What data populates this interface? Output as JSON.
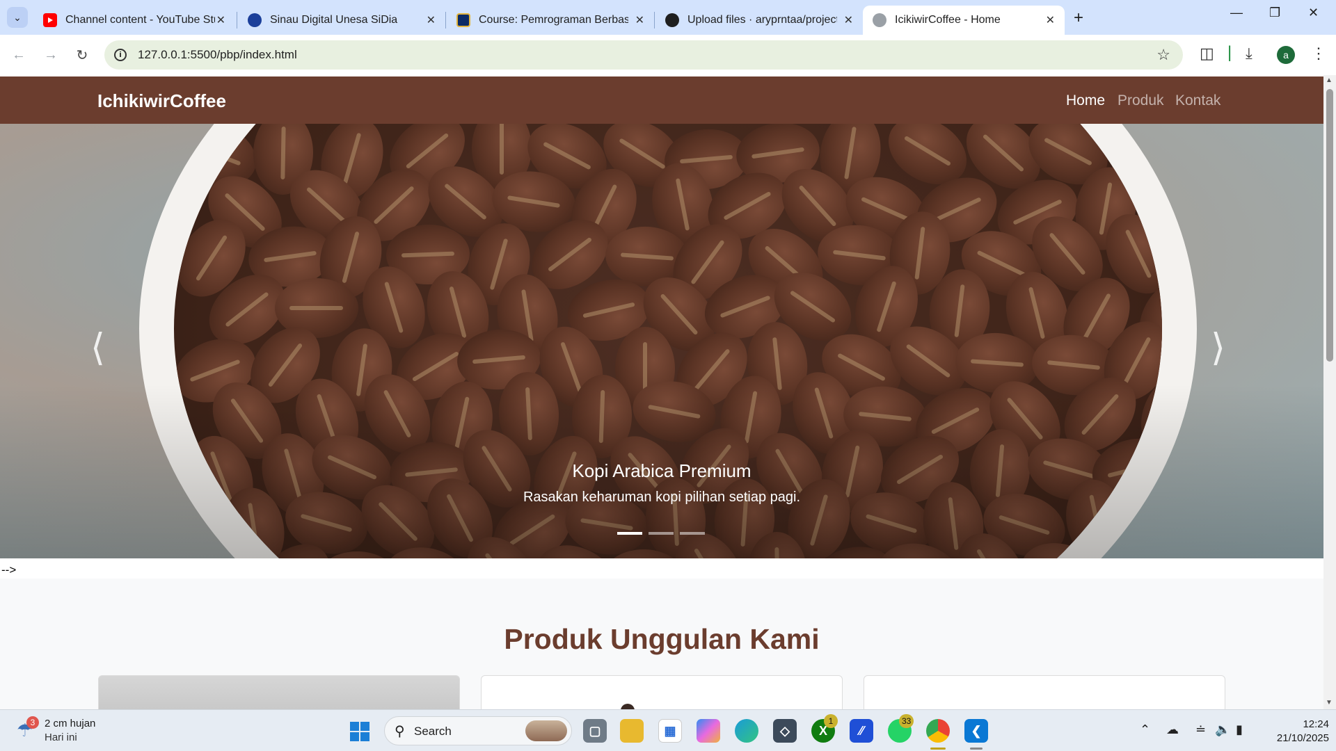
{
  "browser": {
    "tabs": [
      {
        "title": "Channel content - YouTube Stu",
        "icon": "youtube-icon",
        "active": false
      },
      {
        "title": "Sinau Digital Unesa SiDia",
        "icon": "sidia-icon",
        "active": false
      },
      {
        "title": "Course: Pemrograman Berbasis",
        "icon": "course-icon",
        "active": false
      },
      {
        "title": "Upload files · aryprntaa/project",
        "icon": "github-icon",
        "active": false
      },
      {
        "title": "IcikiwirCoffee - Home",
        "icon": "globe-icon",
        "active": true
      }
    ],
    "url": "127.0.0.1:5500/pbp/index.html",
    "profile_initial": "a"
  },
  "site": {
    "brand": "IchikiwirCoffee",
    "nav": [
      "Home",
      "Produk",
      "Kontak"
    ],
    "hero": {
      "title": "Kopi Arabica Premium",
      "text": "Rasakan keharuman kopi pilihan setiap pagi.",
      "slide_count": 3,
      "active_slide": 1
    },
    "stray_text": "-->",
    "section_title": "Produk Unggulan Kami",
    "colors": {
      "brand": "#6b3d2e",
      "section_bg": "#f8f9fa"
    }
  },
  "taskbar": {
    "weather": {
      "line1": "2 cm hujan",
      "line2": "Hari ini",
      "badge": "3"
    },
    "search_label": "Search",
    "badges": {
      "xbox": "1",
      "whatsapp": "33"
    },
    "time": "12:24",
    "date": "21/10/2025"
  }
}
